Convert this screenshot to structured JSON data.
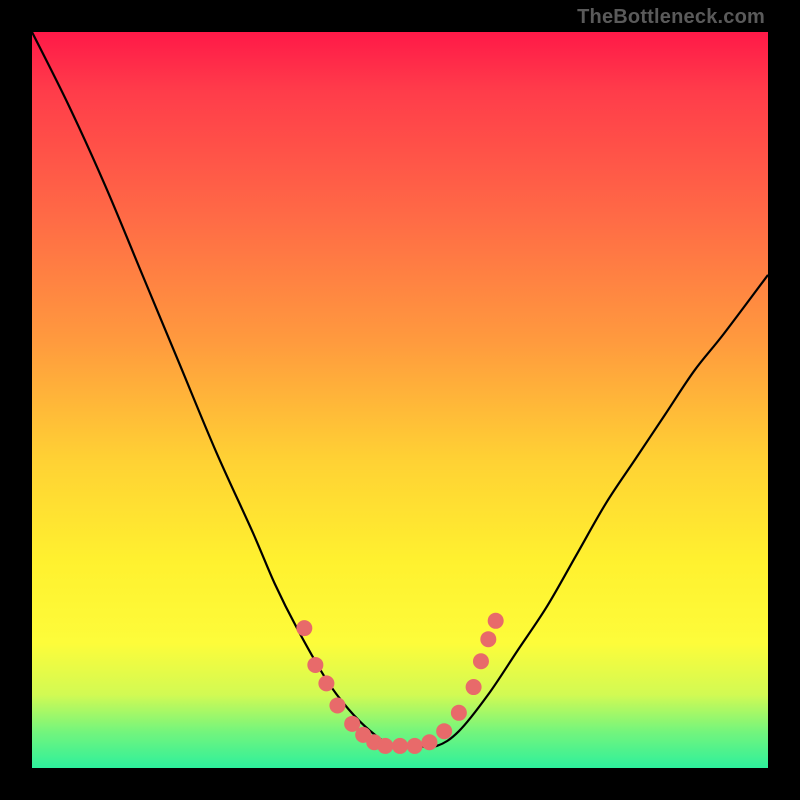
{
  "attribution": "TheBottleneck.com",
  "chart_data": {
    "type": "line",
    "title": "",
    "xlabel": "",
    "ylabel": "",
    "ylim": [
      0,
      100
    ],
    "series": [
      {
        "name": "curve",
        "x": [
          0,
          5,
          10,
          15,
          20,
          25,
          30,
          33,
          36,
          40,
          43,
          46,
          49,
          52,
          55,
          58,
          62,
          66,
          70,
          74,
          78,
          82,
          86,
          90,
          94,
          100
        ],
        "values": [
          100,
          90,
          79,
          67,
          55,
          43,
          32,
          25,
          19,
          12,
          8,
          5,
          3,
          3,
          3,
          5,
          10,
          16,
          22,
          29,
          36,
          42,
          48,
          54,
          59,
          67
        ]
      }
    ],
    "markers": [
      {
        "x": 37.0,
        "y": 19.0
      },
      {
        "x": 38.5,
        "y": 14.0
      },
      {
        "x": 40.0,
        "y": 11.5
      },
      {
        "x": 41.5,
        "y": 8.5
      },
      {
        "x": 43.5,
        "y": 6.0
      },
      {
        "x": 45.0,
        "y": 4.5
      },
      {
        "x": 46.5,
        "y": 3.5
      },
      {
        "x": 48.0,
        "y": 3.0
      },
      {
        "x": 50.0,
        "y": 3.0
      },
      {
        "x": 52.0,
        "y": 3.0
      },
      {
        "x": 54.0,
        "y": 3.5
      },
      {
        "x": 56.0,
        "y": 5.0
      },
      {
        "x": 58.0,
        "y": 7.5
      },
      {
        "x": 60.0,
        "y": 11.0
      },
      {
        "x": 61.0,
        "y": 14.5
      },
      {
        "x": 62.0,
        "y": 17.5
      },
      {
        "x": 63.0,
        "y": 20.0
      }
    ],
    "colors": {
      "line": "#000000",
      "marker": "#e86a6a"
    }
  }
}
